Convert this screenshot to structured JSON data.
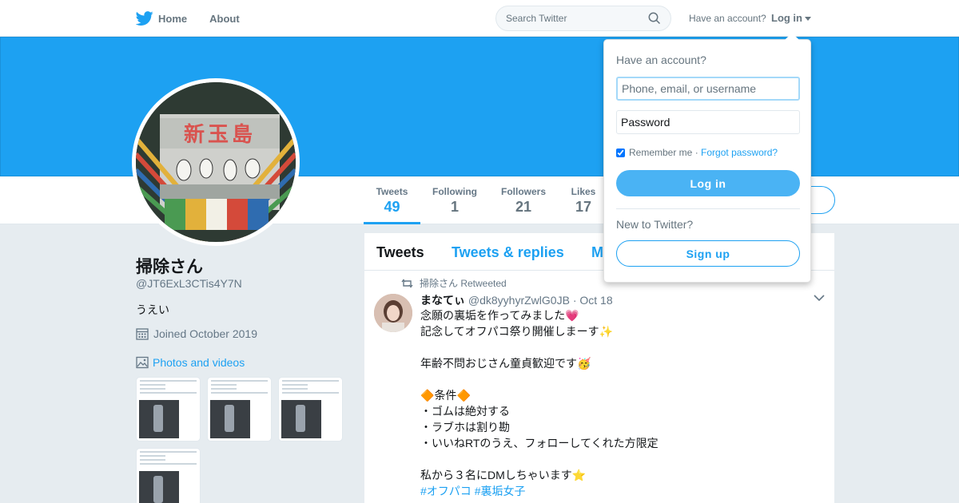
{
  "nav": {
    "home_label": "Home",
    "about_label": "About",
    "search_placeholder": "Search Twitter",
    "have_account_text": "Have an account?",
    "login_label": "Log in",
    "brand_color": "#1da1f2"
  },
  "profile": {
    "name": "掃除さん",
    "handle": "@JT6ExL3CTis4Y7N",
    "bio": "うえい",
    "joined": "Joined October 2019",
    "photos_label": "Photos and videos",
    "banner_color": "#1da1f2"
  },
  "stats": [
    {
      "label": "Tweets",
      "value": "49",
      "active": true
    },
    {
      "label": "Following",
      "value": "1",
      "active": false
    },
    {
      "label": "Followers",
      "value": "21",
      "active": false
    },
    {
      "label": "Likes",
      "value": "17",
      "active": false
    }
  ],
  "timeline": {
    "tabs": [
      {
        "label": "Tweets",
        "active": true
      },
      {
        "label": "Tweets & replies",
        "active": false
      },
      {
        "label": "M",
        "active": false
      }
    ],
    "tweet": {
      "retweet_note": "掃除さん Retweeted",
      "author_name": "まなてぃ",
      "author_handle": "@dk8yyhyrZwlG0JB",
      "separator": "·",
      "date": "Oct 18",
      "lines": [
        "念願の裏垢を作ってみました",
        "記念してオフパコ祭り開催しまーす",
        "",
        "年齢不問おじさん童貞歓迎です",
        "",
        "条件",
        "・ゴムは絶対する",
        "・ラブホは割り勘",
        "・いいねRTのうえ、フォローしてくれた方限定",
        "",
        "私から３名にDMしちゃいます"
      ],
      "hashtags": [
        "#オフパコ",
        "#裏垢女子"
      ],
      "emoji": {
        "heart": "💗",
        "sparkles": "✨",
        "party": "🥳",
        "diamond": "🔶",
        "star": "⭐"
      }
    }
  },
  "login_dropdown": {
    "title": "Have an account?",
    "username_placeholder": "Phone, email, or username",
    "password_placeholder": "Password",
    "remember_label": "Remember me",
    "separator": "·",
    "forgot_label": "Forgot password?",
    "login_button": "Log in",
    "new_label": "New to Twitter?",
    "signup_button": "Sign up"
  }
}
